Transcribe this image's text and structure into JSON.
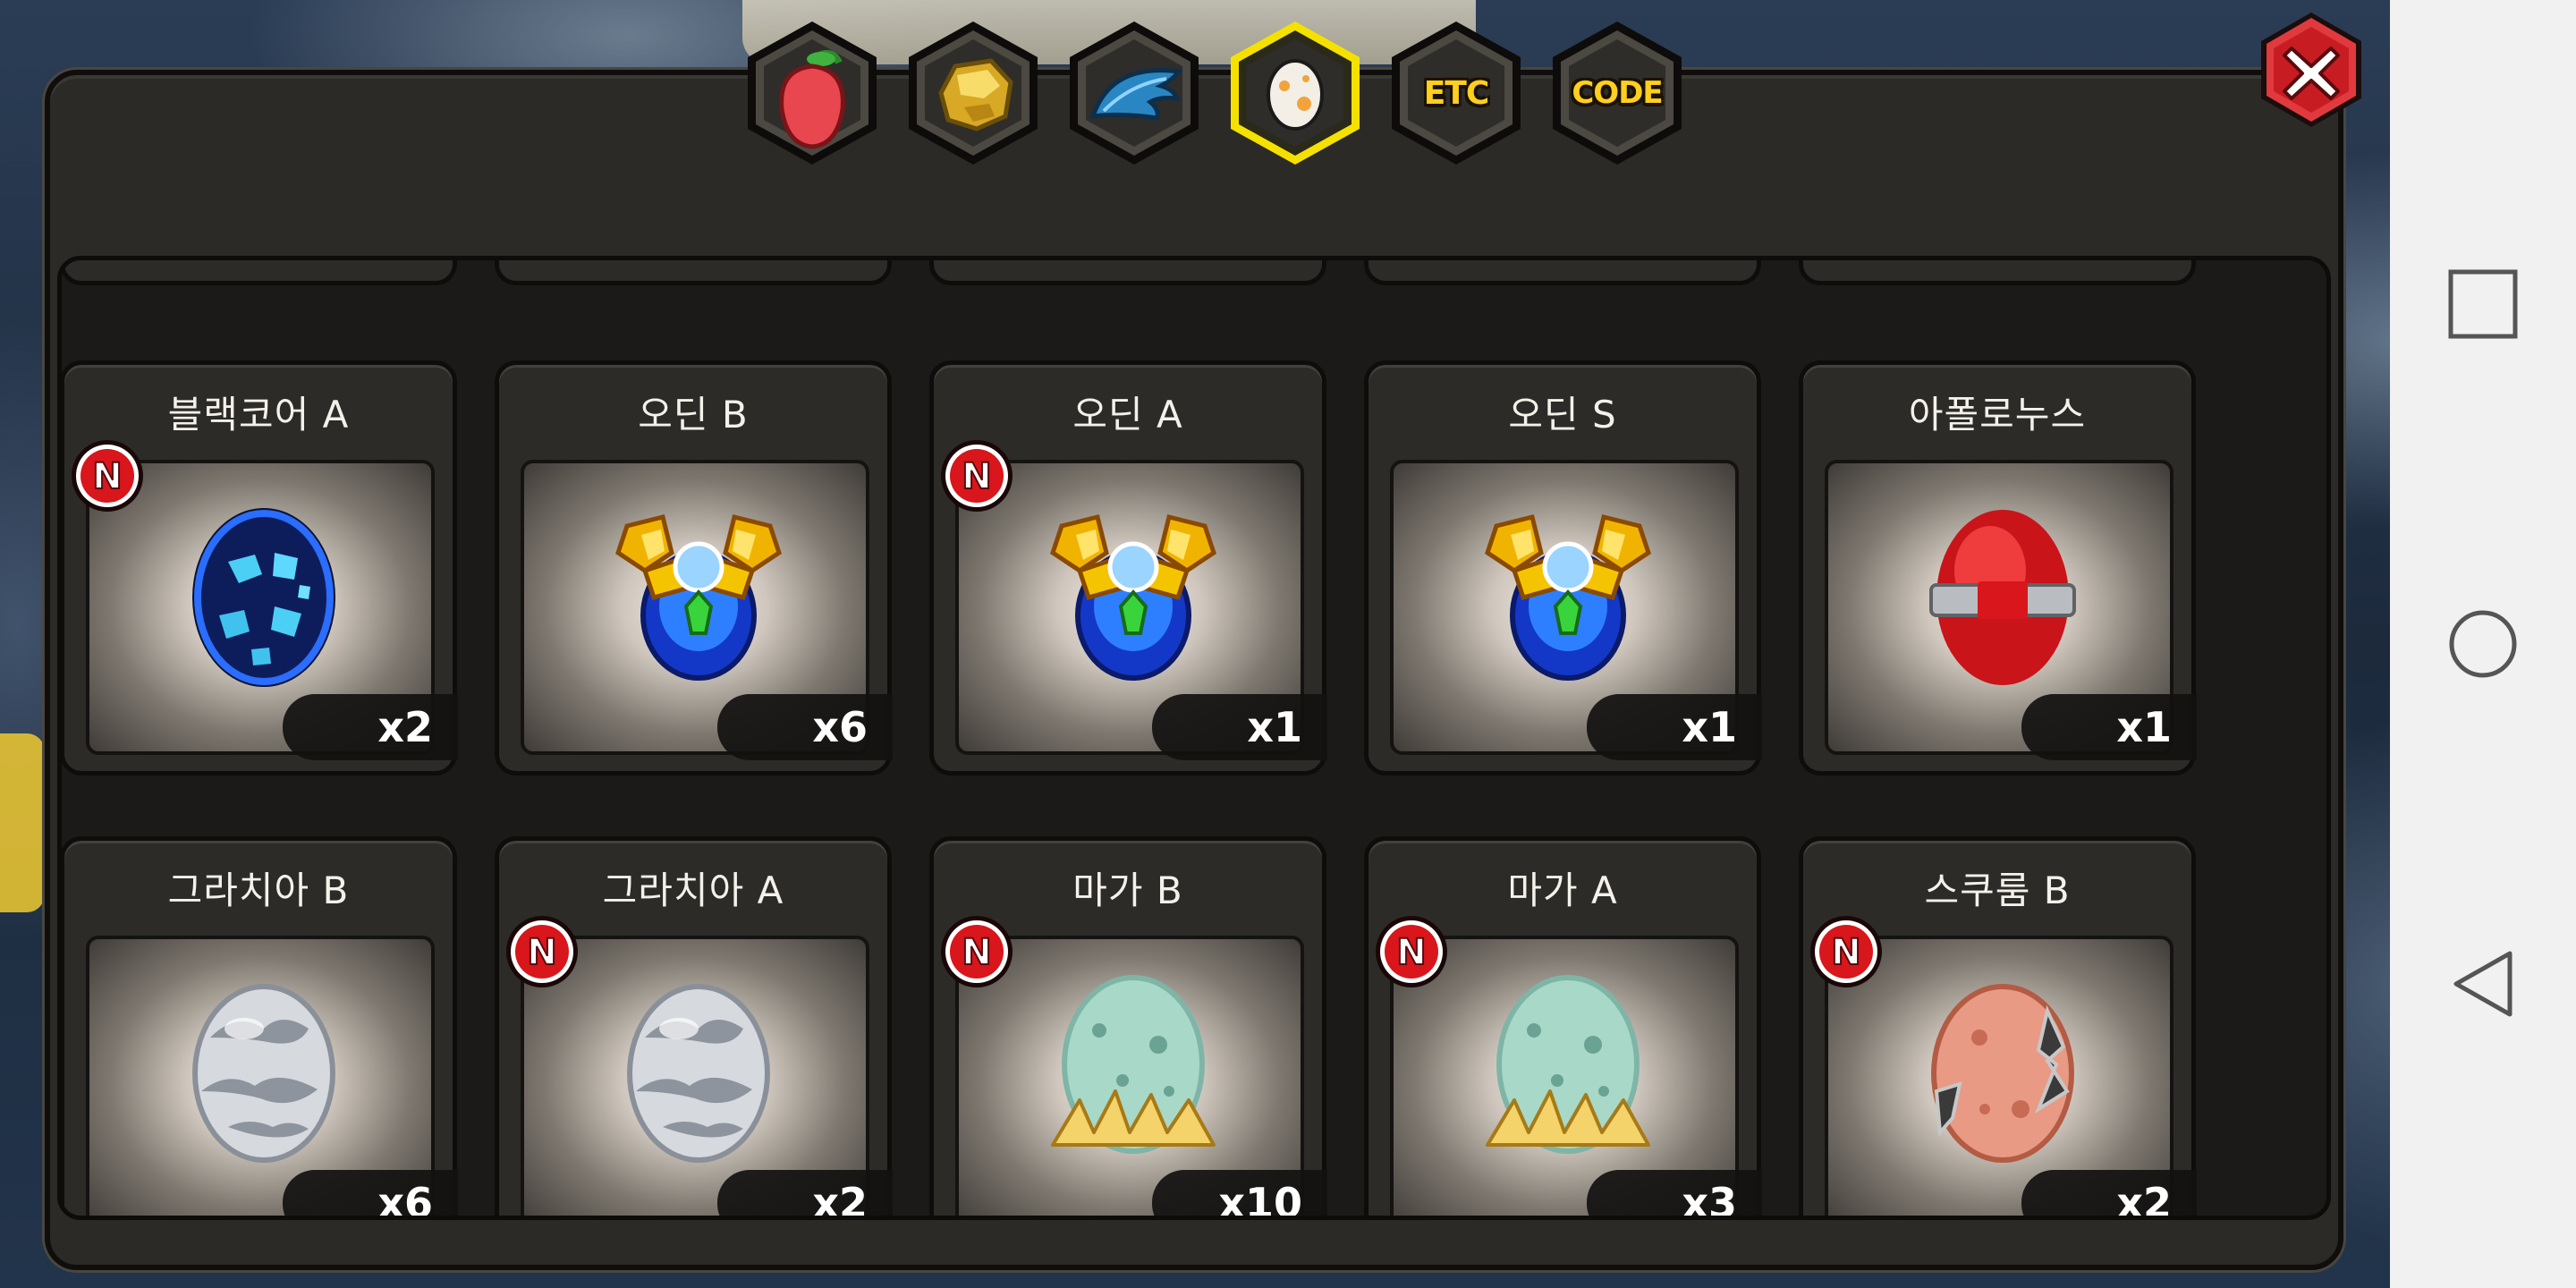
{
  "tabs": [
    {
      "name": "fruit",
      "icon": "fruit-icon",
      "label": ""
    },
    {
      "name": "gold",
      "icon": "gold-nugget-icon",
      "label": ""
    },
    {
      "name": "wing",
      "icon": "blue-feather-icon",
      "label": ""
    },
    {
      "name": "egg",
      "icon": "egg-icon",
      "label": "",
      "selected": true
    },
    {
      "name": "etc",
      "icon": "",
      "label": "ETC"
    },
    {
      "name": "code",
      "icon": "",
      "label": "CODE"
    }
  ],
  "items": [
    {
      "name": "블랙코어 A",
      "count": "x2",
      "is_new": true,
      "egg": "black-core-egg-icon"
    },
    {
      "name": "오딘 B",
      "count": "x6",
      "is_new": false,
      "egg": "odin-egg-icon"
    },
    {
      "name": "오딘 A",
      "count": "x1",
      "is_new": true,
      "egg": "odin-egg-icon"
    },
    {
      "name": "오딘 S",
      "count": "x1",
      "is_new": false,
      "egg": "odin-egg-icon"
    },
    {
      "name": "아폴로누스",
      "count": "x1",
      "is_new": false,
      "egg": "red-egg-icon"
    },
    {
      "name": "그라치아 B",
      "count": "x6",
      "is_new": false,
      "egg": "silver-cloud-egg-icon"
    },
    {
      "name": "그라치아 A",
      "count": "x2",
      "is_new": true,
      "egg": "silver-cloud-egg-icon"
    },
    {
      "name": "마가 B",
      "count": "x10",
      "is_new": true,
      "egg": "mint-nest-egg-icon"
    },
    {
      "name": "마가 A",
      "count": "x3",
      "is_new": true,
      "egg": "mint-nest-egg-icon"
    },
    {
      "name": "스쿠룸 B",
      "count": "x2",
      "is_new": true,
      "egg": "cracked-peach-egg-icon"
    }
  ],
  "new_badge_label": "N",
  "colors": {
    "tab_highlight": "#f5e100",
    "tab_text": "#ffcf1e",
    "new_badge": "#d8161b",
    "close_button": "#d61f26"
  }
}
